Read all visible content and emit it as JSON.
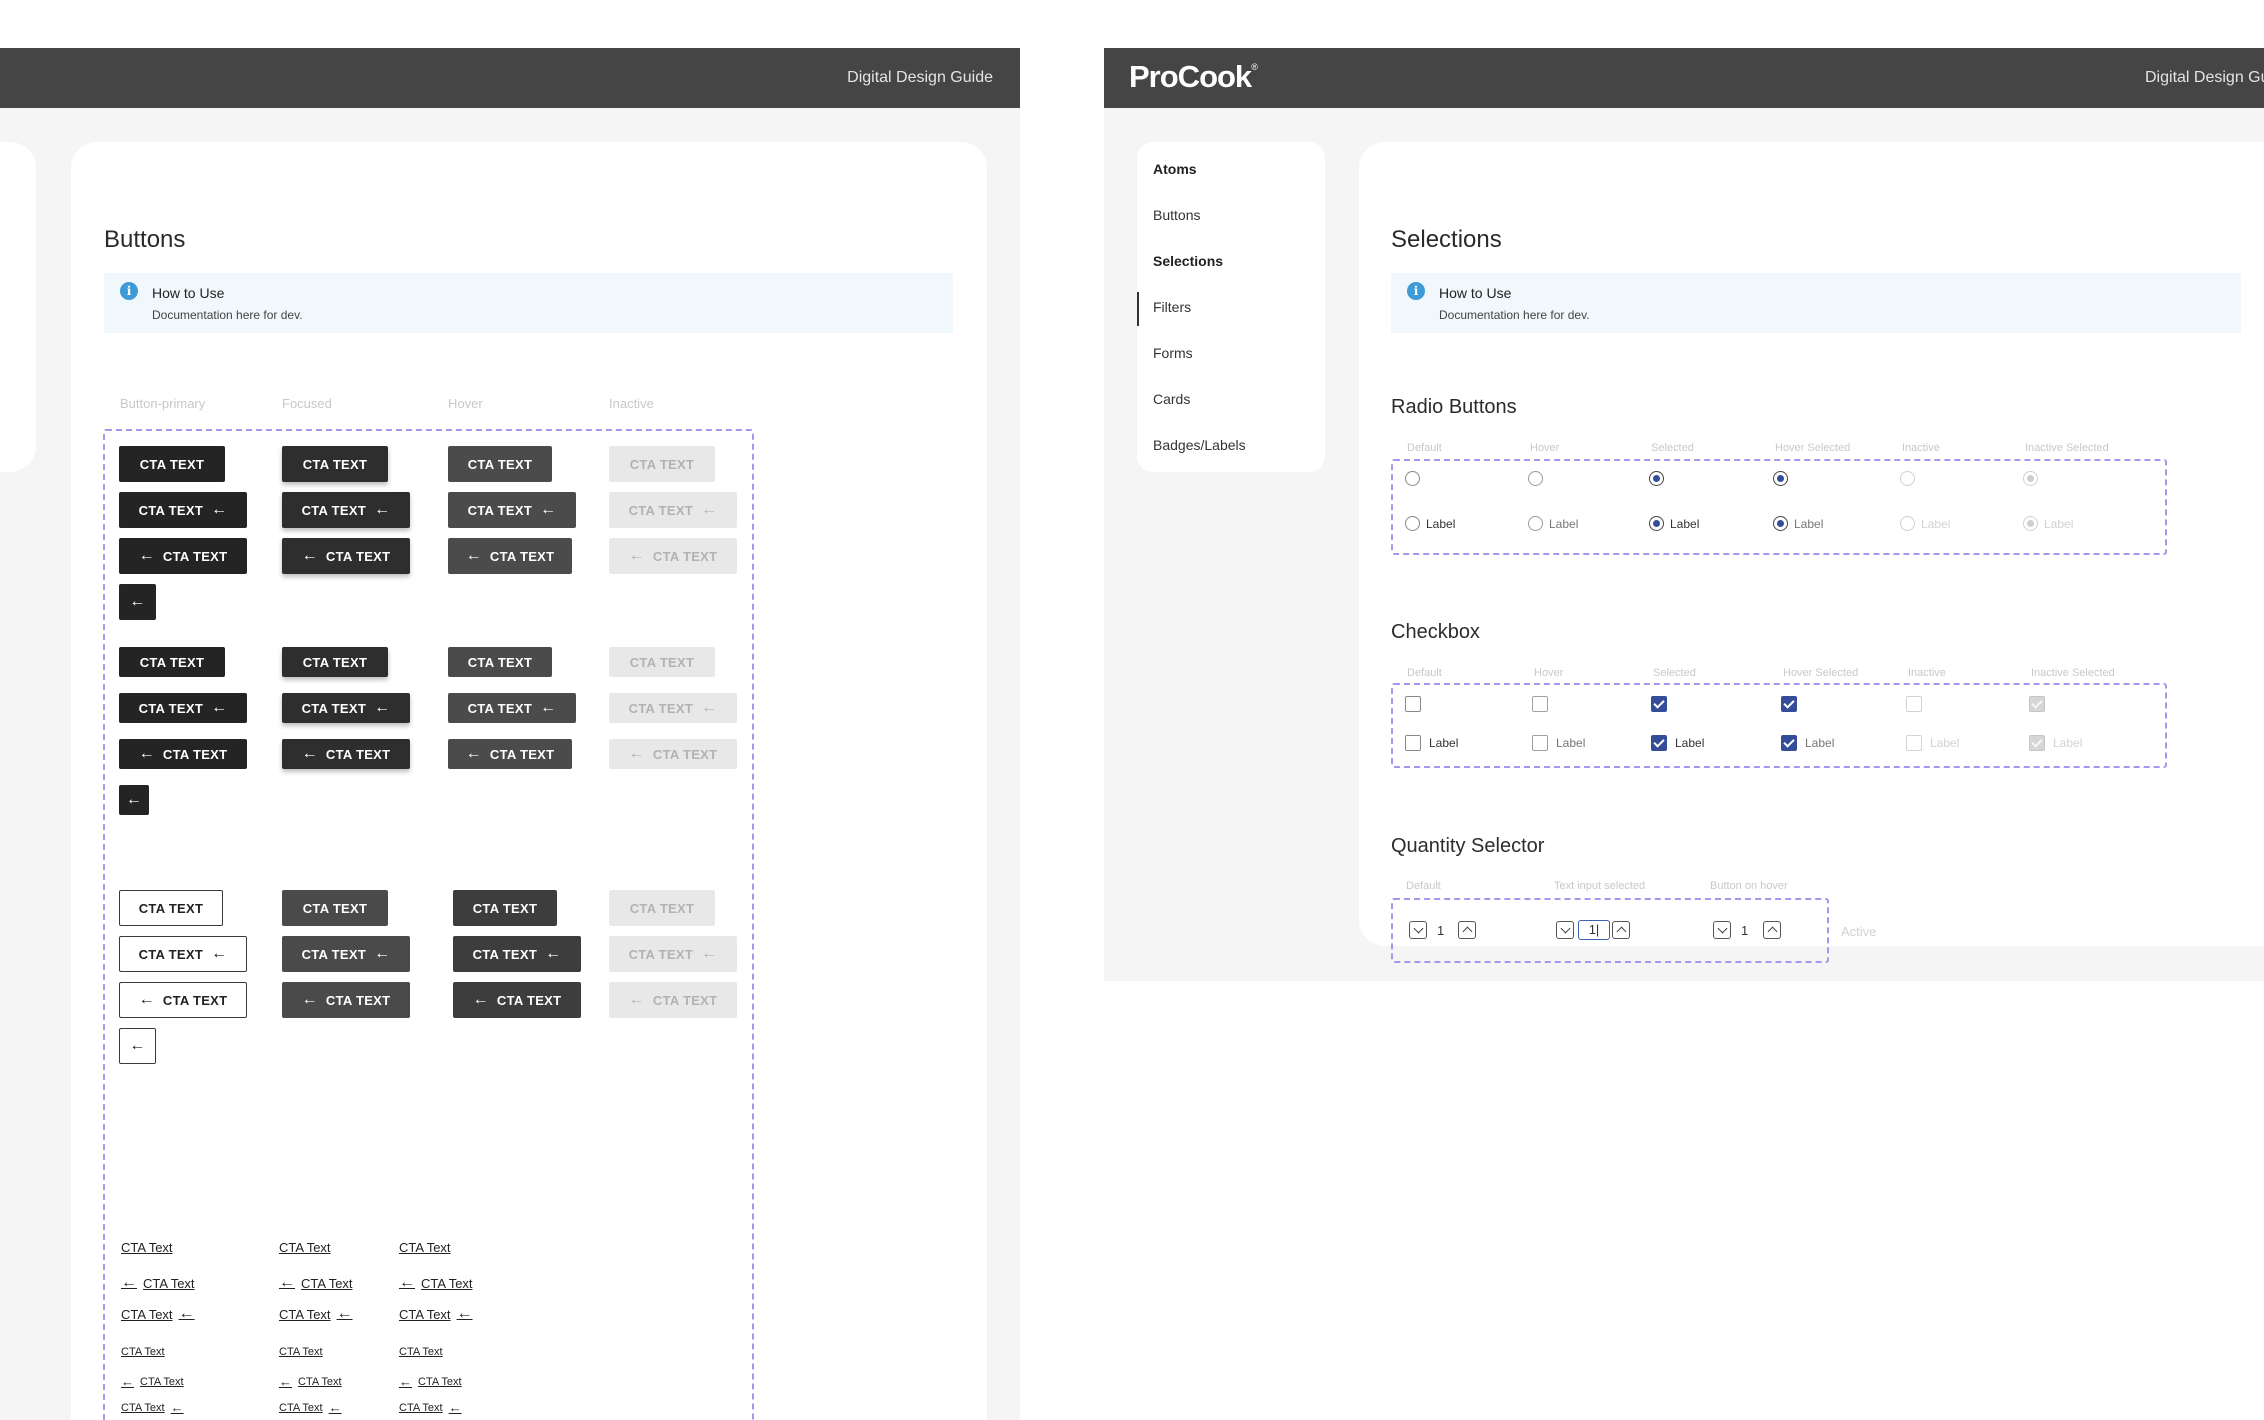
{
  "left": {
    "header": {
      "title": "Digital Design Guide"
    },
    "page_title": "Buttons",
    "info": {
      "title": "How to Use",
      "text": "Documentation here for dev."
    },
    "columns": [
      "Button-primary",
      "Focused",
      "Hover",
      "Inactive"
    ],
    "cta_upper": "CTA TEXT",
    "cta_link": "CTA Text",
    "arrow_glyph": "←"
  },
  "right": {
    "header": {
      "logo": "ProCook",
      "logo_mark": "®",
      "title": "Digital Design Guide"
    },
    "nav": [
      "Atoms",
      "Buttons",
      "Selections",
      "Filters",
      "Forms",
      "Cards",
      "Badges/Labels"
    ],
    "page_title": "Selections",
    "info": {
      "title": "How to Use",
      "text": "Documentation here for dev."
    },
    "radio": {
      "title": "Radio Buttons",
      "columns": [
        "Default",
        "Hover",
        "Selected",
        "Hover Selected",
        "Inactive",
        "Inactive Selected"
      ],
      "label": "Label"
    },
    "checkbox": {
      "title": "Checkbox",
      "columns": [
        "Default",
        "Hover",
        "Selected",
        "Hover Selected",
        "Inactive",
        "Inactive Selected"
      ],
      "label": "Label"
    },
    "quantity": {
      "title": "Quantity Selector",
      "columns": [
        "Default",
        "Text input selected",
        "Button on hover"
      ],
      "value": "1",
      "input_value": "1|",
      "active_label": "Active"
    }
  },
  "colors": {
    "accent": "#344d98",
    "dashed": "#a696f0",
    "header": "#454545",
    "info": "#3e9bd6"
  }
}
